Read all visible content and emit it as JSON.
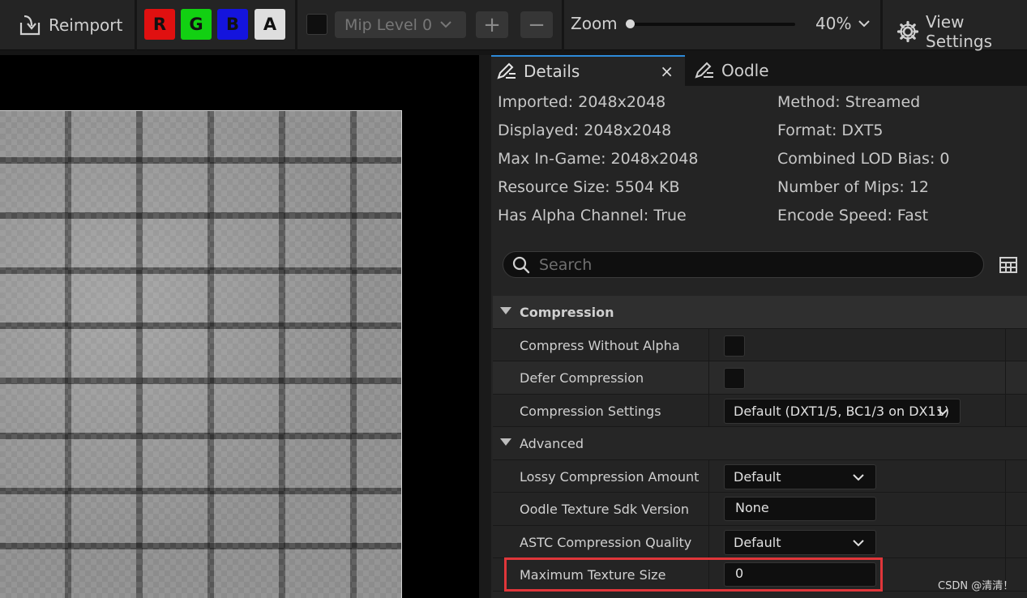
{
  "toolbar": {
    "reimport_label": "Reimport",
    "channels": [
      {
        "label": "R",
        "color": "#e01010"
      },
      {
        "label": "G",
        "color": "#12d012"
      },
      {
        "label": "B",
        "color": "#1414dd"
      },
      {
        "label": "A",
        "color": "#dedede"
      }
    ],
    "mip_level": "Mip Level 0",
    "plus": "+",
    "minus": "−",
    "zoom_label": "Zoom",
    "zoom_value": "40%",
    "zoom_fraction": 0.0,
    "view_settings_label": "View Settings"
  },
  "tabs": {
    "details": "Details",
    "close": "×",
    "oodle": "Oodle"
  },
  "info_left": [
    "Imported: 2048x2048",
    "Displayed: 2048x2048",
    "Max In-Game: 2048x2048",
    "Resource Size: 5504 KB",
    "Has Alpha Channel: True"
  ],
  "info_right": [
    "Method: Streamed",
    "Format: DXT5",
    "Combined LOD Bias: 0",
    "Number of Mips: 12",
    "Encode Speed: Fast"
  ],
  "search": {
    "placeholder": "Search"
  },
  "compression": {
    "category": "Compression",
    "compress_without_alpha": "Compress Without Alpha",
    "defer_compression": "Defer Compression",
    "compression_settings": "Compression Settings",
    "compression_settings_value": "Default (DXT1/5, BC1/3 on DX11)"
  },
  "advanced": {
    "category": "Advanced",
    "lossy_amount": "Lossy Compression Amount",
    "lossy_amount_value": "Default",
    "oodle_sdk": "Oodle Texture Sdk Version",
    "oodle_sdk_value": "None",
    "astc_quality": "ASTC Compression Quality",
    "astc_quality_value": "Default",
    "max_texture_size": "Maximum Texture Size",
    "max_texture_size_value": "0"
  },
  "watermark": "CSDN @清清！",
  "highlight_color": "#e0363a"
}
